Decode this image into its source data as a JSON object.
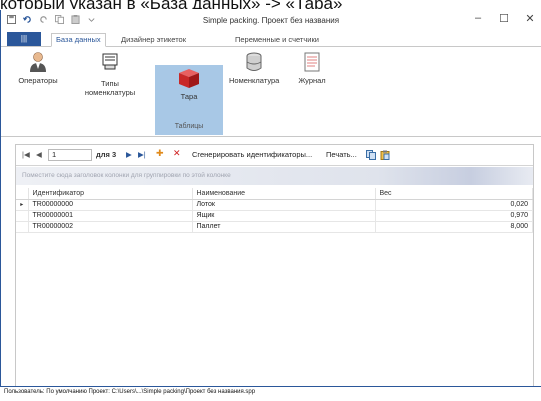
{
  "outer_caption": "который указан в «База данных» -> «Тара»",
  "window": {
    "title": "Simple packing. Проект без названия",
    "controls": {
      "minimize": "–",
      "maximize": "☐",
      "close": "✕"
    }
  },
  "ribbon": {
    "file_tab": "|||",
    "tabs": [
      "База данных",
      "Дизайнер этикеток",
      "Переменные и счетчики"
    ],
    "buttons": {
      "operators": "Операторы",
      "item_types": "Типы номенклатуры",
      "tare": "Тара",
      "nomenclature": "Номенклатура",
      "journal": "Журнал"
    },
    "group_label": "Таблицы"
  },
  "navigator": {
    "first": "|◀",
    "prev": "◀",
    "page_value": "1",
    "of_total": "для 3",
    "next": "▶",
    "last": "▶|",
    "add": "✚",
    "delete": "✕",
    "generate": "Сгенерировать идентификаторы...",
    "print": "Печать..."
  },
  "group_panel_text": "Поместите сюда заголовок колонки для группировки по этой колонке",
  "table": {
    "row_indicator": "▸",
    "columns": [
      "Идентификатор",
      "Наименование",
      "Вес"
    ],
    "rows": [
      {
        "id": "TR00000000",
        "name": "Лоток",
        "weight": "0,020"
      },
      {
        "id": "TR00000001",
        "name": "Ящик",
        "weight": "0,970"
      },
      {
        "id": "TR00000002",
        "name": "Паллет",
        "weight": "8,000"
      }
    ]
  },
  "statusbar_text": "Пользователь: По умолчанию   Проект: C:\\Users\\...\\Simple packing\\Проект без названия.spp"
}
